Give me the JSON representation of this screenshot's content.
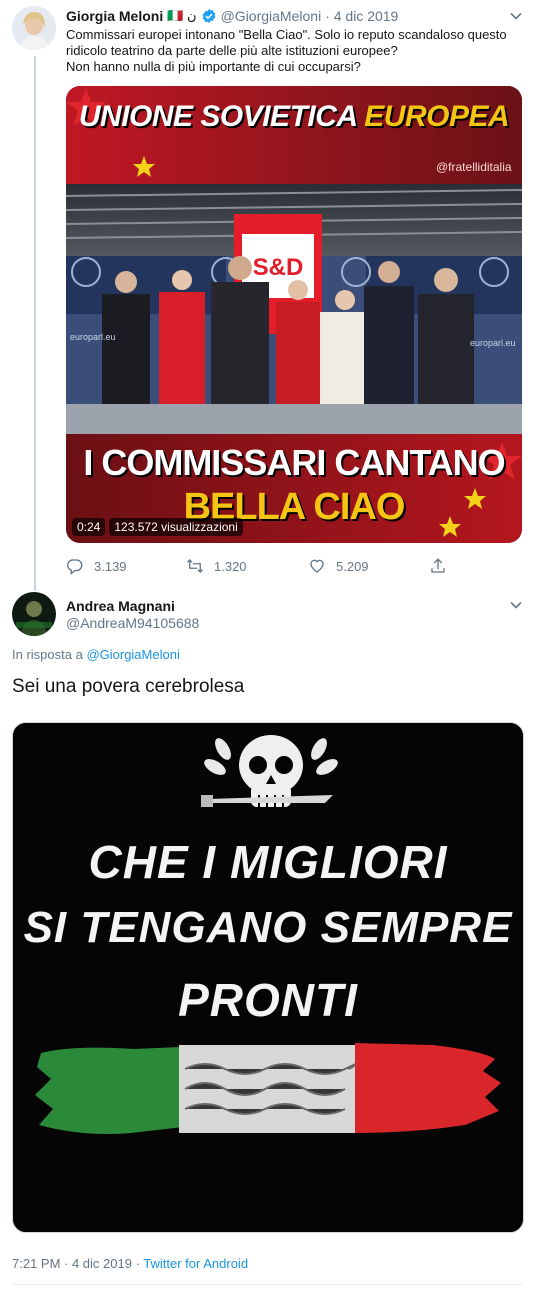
{
  "tweet": {
    "author_name": "Giorgia Meloni",
    "author_extra": "🇮🇹 ن",
    "handle": "@GiorgiaMeloni",
    "date": "· 4 dic 2019",
    "text_line1": "Commissari europei intonano \"Bella Ciao\". Solo io reputo scandaloso questo",
    "text_line2": "ridicolo teatrino da parte delle più alte istituzioni europee?",
    "text_line3": "Non hanno nulla di più importante di cui occuparsi?",
    "video": {
      "title_top_a": "UNIONE SOVIETICA ",
      "title_top_b": "EUROPEA",
      "watermark": "@fratelliditalia",
      "banner_sign": "S&D",
      "wall_text_left": "europarl.eu",
      "wall_text_right": "europarl.eu",
      "bottom_line1": "I COMMISSARI CANTANO",
      "bottom_line2": "BELLA CIAO",
      "duration": "0:24",
      "views": "123.572 visualizzazioni"
    },
    "actions": {
      "replies": "3.139",
      "retweets": "1.320",
      "likes": "5.209"
    }
  },
  "reply": {
    "author_name": "Andrea Magnani",
    "handle": "@AndreaM94105688",
    "in_reply_prefix": "In risposta a ",
    "in_reply_handle": "@GiorgiaMeloni",
    "text": "Sei una povera cerebrolesa",
    "image": {
      "line1": "CHE I MIGLIORI",
      "line2": "SI TENGANO SEMPRE",
      "line3": "PRONTI"
    },
    "timestamp": "7:21 PM · 4 dic 2019 · ",
    "source": "Twitter for Android"
  },
  "colors": {
    "link": "#1b95e0",
    "muted": "#657786",
    "verified": "#1da1f2"
  }
}
